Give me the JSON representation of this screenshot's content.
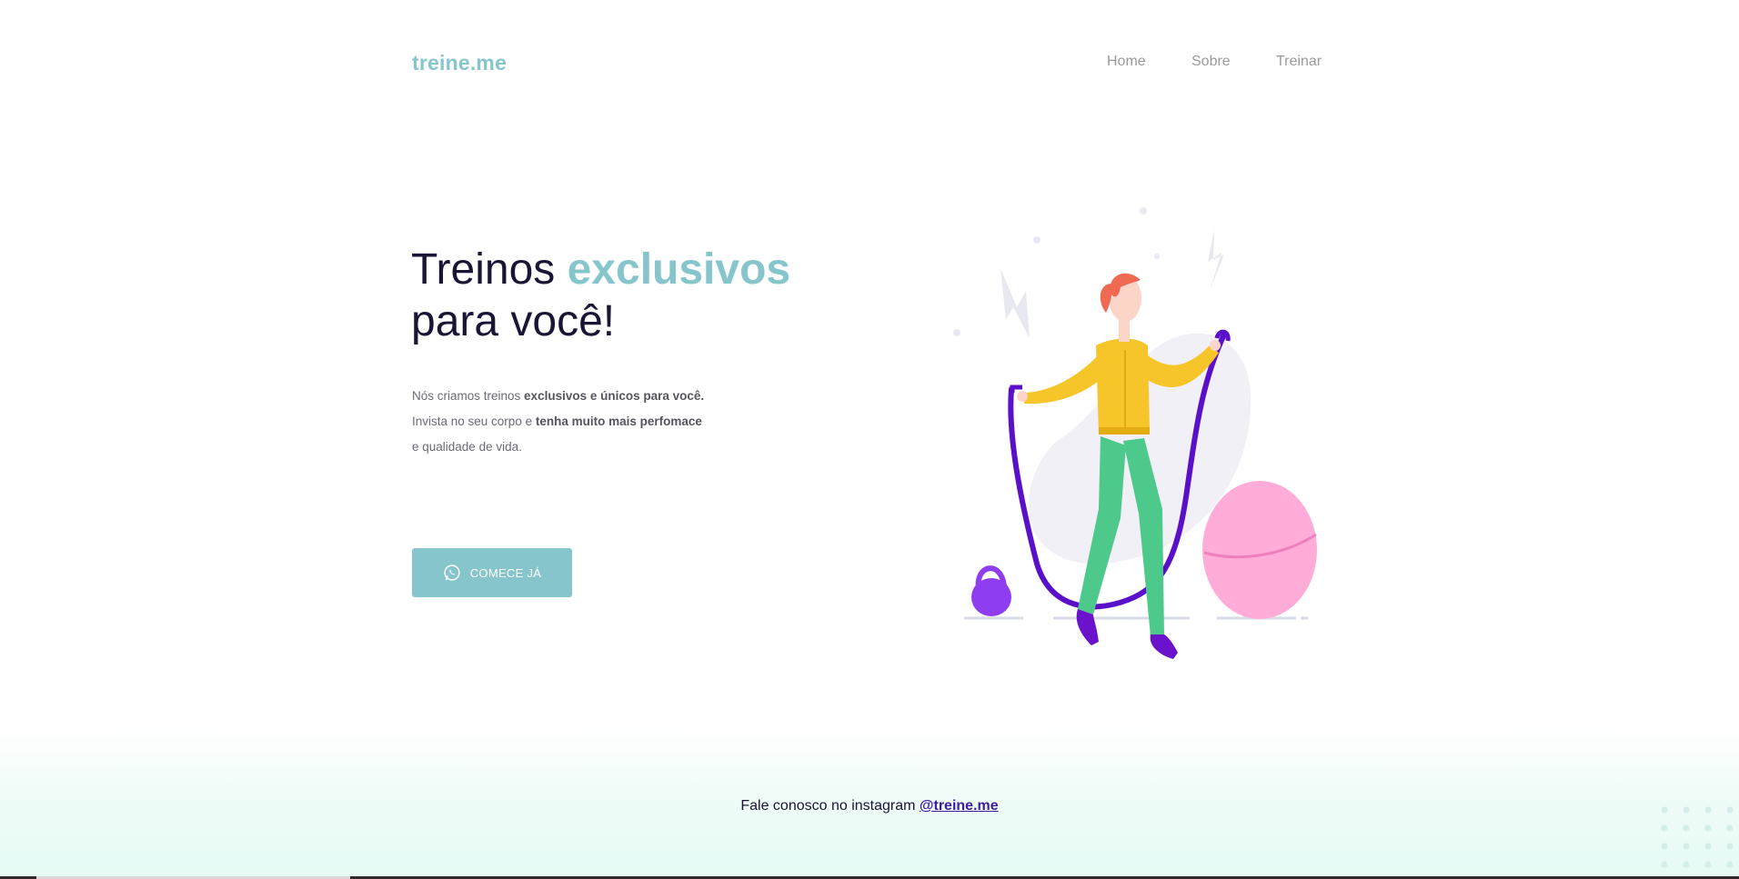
{
  "header": {
    "logo": "treine.me",
    "nav": [
      {
        "label": "Home"
      },
      {
        "label": "Sobre"
      },
      {
        "label": "Treinar"
      }
    ]
  },
  "hero": {
    "title_part1": "Treinos ",
    "title_accent": "exclusivos",
    "title_part2": "para você!",
    "text": {
      "l1_plain": "Nós criamos treinos ",
      "l1_bold": "exclusivos e únicos para você.",
      "l2_plain": "Invista no seu corpo e ",
      "l2_bold": "tenha muito mais perfomace",
      "l3_plain": "e qualidade de vida."
    },
    "cta_label": "COMECE JÁ",
    "cta_icon": "whatsapp-icon"
  },
  "footer": {
    "text": "Fale conosco no instagram ",
    "instagram_handle": "@treine.me"
  },
  "colors": {
    "accent": "#86c5cc",
    "dark_text": "#1b1535",
    "link": "#3d1ba1",
    "footer_bg": "#e6faf4"
  }
}
